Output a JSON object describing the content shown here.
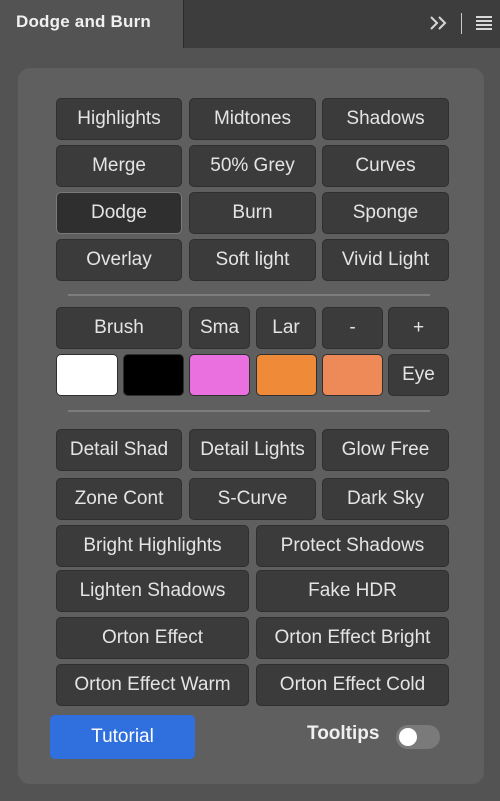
{
  "tab": {
    "title": "Dodge and Burn"
  },
  "icons": {
    "collapse": "double-chevron-right-icon",
    "menu": "hamburger-menu-icon"
  },
  "modes": {
    "row1": [
      "Highlights",
      "Midtones",
      "Shadows"
    ],
    "row2": [
      "Merge",
      "50% Grey",
      "Curves"
    ],
    "row3": [
      "Dodge",
      "Burn",
      "Sponge"
    ],
    "row4": [
      "Overlay",
      "Soft light",
      "Vivid Light"
    ],
    "active": "Dodge"
  },
  "brush": {
    "label": "Brush",
    "small": "Sma",
    "large": "Lar",
    "minus": "-",
    "plus": "+"
  },
  "colors": {
    "swatches": [
      "#ffffff",
      "#000000",
      "#ea70df",
      "#ee8a38",
      "#ee8a58"
    ],
    "eye_label": "Eye"
  },
  "presets": {
    "detail_shad": "Detail Shad",
    "detail_lights": "Detail Lights",
    "glow_free": "Glow Free",
    "zone_cont": "Zone Cont",
    "s_curve": "S-Curve",
    "dark_sky": "Dark Sky",
    "bright_highlights": "Bright Highlights",
    "protect_shadows": "Protect Shadows",
    "lighten_shadows": "Lighten Shadows",
    "fake_hdr": "Fake HDR",
    "orton_effect": "Orton Effect",
    "orton_effect_bright": "Orton Effect Bright",
    "orton_effect_warm": "Orton Effect Warm",
    "orton_effect_cold": "Orton Effect Cold"
  },
  "footer": {
    "tutorial_label": "Tutorial",
    "tooltips_label": "Tooltips",
    "tooltips_on": false
  },
  "accent_color": "#2f6fde"
}
